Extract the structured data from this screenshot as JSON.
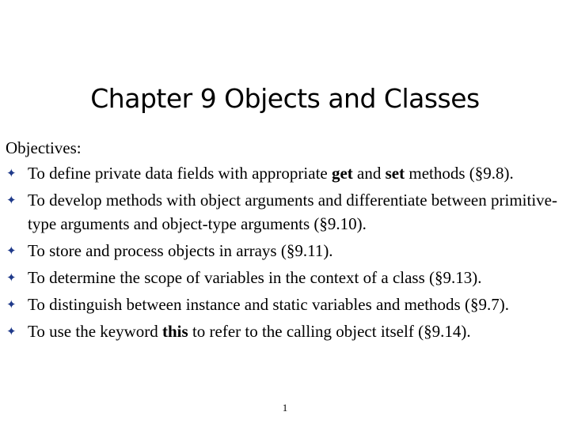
{
  "title": "Chapter 9 Objects and Classes",
  "objectives_label": "Objectives:",
  "bullet_icon": "four-pointed-star",
  "colors": {
    "bullet": "#1f3a8a",
    "text": "#000000",
    "background": "#ffffff"
  },
  "objectives": [
    {
      "parts": [
        {
          "text": "To define private data fields with appropriate "
        },
        {
          "text": "get",
          "bold": true
        },
        {
          "text": " and "
        },
        {
          "text": "set",
          "bold": true
        },
        {
          "text": " methods (§9.8)."
        }
      ]
    },
    {
      "parts": [
        {
          "text": "To develop methods with object arguments and differentiate between primitive-type arguments and object-type arguments (§9.10)."
        }
      ]
    },
    {
      "parts": [
        {
          "text": "To store and process objects in arrays (§9.11)."
        }
      ]
    },
    {
      "parts": [
        {
          "text": "To determine the scope of variables in the context of a class (§9.13)."
        }
      ]
    },
    {
      "parts": [
        {
          "text": "To distinguish between instance and static variables and methods (§9.7)."
        }
      ]
    },
    {
      "parts": [
        {
          "text": "To use the keyword "
        },
        {
          "text": "this",
          "bold": true
        },
        {
          "text": " to refer to the calling object itself (§9.14)."
        }
      ]
    }
  ],
  "page_number": "1"
}
